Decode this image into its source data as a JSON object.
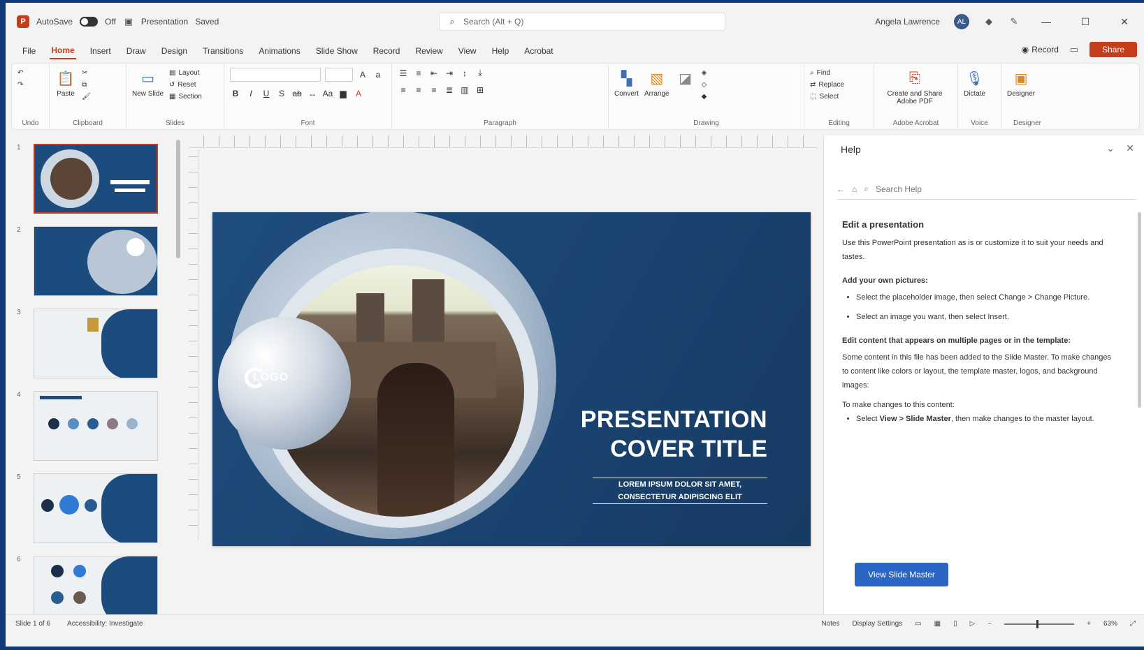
{
  "titlebar": {
    "autosave_label": "AutoSave",
    "autosave_state": "Off",
    "file_name": "Presentation",
    "saved_state": "Saved",
    "search_placeholder": "Search (Alt + Q)",
    "user_name": "Angela Lawrence",
    "user_initials": "AL"
  },
  "tabs": {
    "items": [
      "File",
      "Home",
      "Insert",
      "Draw",
      "Design",
      "Transitions",
      "Animations",
      "Slide Show",
      "Record",
      "Review",
      "View",
      "Help",
      "Acrobat"
    ],
    "record_label": "Record",
    "share_label": "Share"
  },
  "ribbon": {
    "groups": {
      "undo": "Undo",
      "clipboard": "Clipboard",
      "slides": "Slides",
      "font": "Font",
      "paragraph": "Paragraph",
      "drawing": "Drawing",
      "editing": "Editing",
      "adobe": "Adobe Acrobat",
      "voice": "Voice",
      "designer": "Designer"
    },
    "paste_label": "Paste",
    "new_slide_label": "New Slide",
    "layout_label": "Layout",
    "reset_label": "Reset",
    "section_label": "Section",
    "convert_label": "Convert",
    "arrange_label": "Arrange",
    "find_label": "Find",
    "replace_label": "Replace",
    "select_label": "Select",
    "create_pdf_label": "Create and Share Adobe PDF",
    "dictate_label": "Dictate",
    "designer_label": "Designer"
  },
  "thumbnails": [
    "1",
    "2",
    "3",
    "4",
    "5",
    "6"
  ],
  "slide": {
    "bubble_text": "LOGO",
    "title_line1": "PRESENTATION",
    "title_line2": "COVER TITLE",
    "subtitle_line1": "LOREM IPSUM DOLOR SIT AMET,",
    "subtitle_line2": "CONSECTETUR ADIPISCING ELIT"
  },
  "help": {
    "pane_title": "Help",
    "search_placeholder": "Search Help",
    "heading": "Edit a presentation",
    "intro": "Use this PowerPoint presentation as is or customize it to suit your needs and tastes.",
    "subheading1": "Add your own pictures:",
    "bullet1": "Select the placeholder image, then select Change > Change Picture.",
    "bullet2": "Select an image you want, then select Insert.",
    "subheading2": "Edit content that appears on multiple pages or in the template:",
    "para2": "Some content in this file has been added to the Slide Master. To make changes to content like colors or layout, the template master, logos, and background images:",
    "para3": "To make changes to this content:",
    "bullet3_prefix": "Select",
    "bullet3_link": "View > Slide Master",
    "bullet3_suffix": ", then make changes to the master layout.",
    "button_label": "View Slide Master"
  },
  "statusbar": {
    "slide_info": "Slide 1 of 6",
    "accessibility": "Accessibility: Investigate",
    "notes_label": "Notes",
    "display_settings": "Display Settings",
    "zoom": "63%"
  }
}
